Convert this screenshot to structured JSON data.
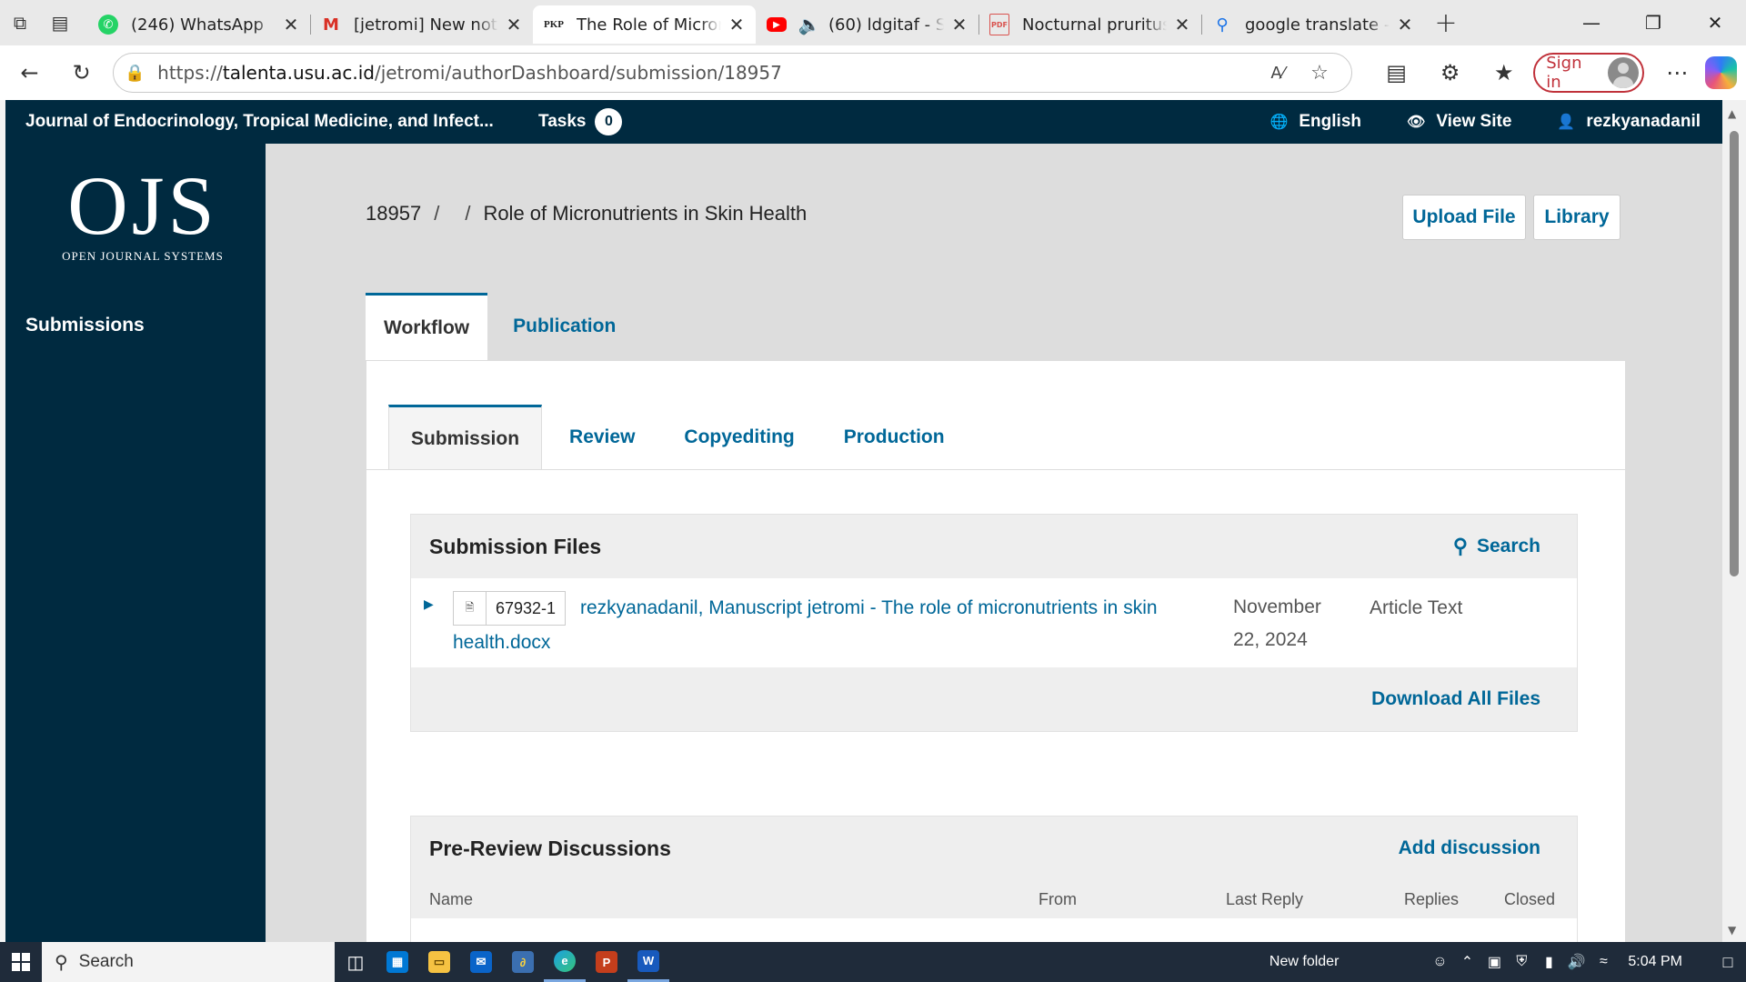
{
  "browser": {
    "tabs": [
      {
        "title": "(246) WhatsApp",
        "favicon": "whatsapp-icon",
        "active": false
      },
      {
        "title": "[jetromi] New notifi",
        "favicon": "gmail-icon",
        "active": false
      },
      {
        "title": "The Role of Micron",
        "favicon": "pkp-icon",
        "favicon_text": "PKP",
        "active": true
      },
      {
        "title": "(60) ldgitaf - S",
        "favicon": "youtube-icon",
        "active": false,
        "audio": true
      },
      {
        "title": "Nocturnal pruritus",
        "favicon": "pdf-icon",
        "active": false
      },
      {
        "title": "google translate - S",
        "favicon": "search-icon",
        "active": false
      }
    ],
    "url_prefix": "https://",
    "url_host": "talenta.usu.ac.id",
    "url_path": "/jetromi/authorDashboard/submission/18957",
    "sign_in": "Sign in"
  },
  "ojs": {
    "journal_name": "Journal of Endocrinology, Tropical Medicine, and Infect...",
    "tasks_label": "Tasks",
    "tasks_count": "0",
    "language": "English",
    "view_site": "View Site",
    "username": "rezkyanadanil",
    "logo_big": "OJS",
    "logo_small": "OPEN JOURNAL SYSTEMS",
    "sidebar_link": "Submissions",
    "breadcrumb": {
      "id": "18957",
      "sep1": "/",
      "sep2": "/",
      "title": "Role of Micronutrients in Skin Health"
    },
    "upload_file": "Upload File",
    "library": "Library",
    "main_tabs": [
      "Workflow",
      "Publication"
    ],
    "stage_tabs": [
      "Submission",
      "Review",
      "Copyediting",
      "Production"
    ],
    "submission_files": {
      "heading": "Submission Files",
      "search": "Search",
      "file": {
        "id": "67932-1",
        "name": "rezkyanadanil, Manuscript jetromi - The role of micronutrients in skin health.docx",
        "date": "November 22, 2024",
        "type": "Article Text"
      },
      "download_all": "Download All Files"
    },
    "discussions": {
      "heading": "Pre-Review Discussions",
      "add": "Add discussion",
      "columns": [
        "Name",
        "From",
        "Last Reply",
        "Replies",
        "Closed"
      ]
    }
  },
  "taskbar": {
    "search": "Search",
    "folder_label": "New folder",
    "time": "5:04 PM"
  },
  "colors": {
    "ojs_dark": "#002a40",
    "ojs_link": "#006798"
  }
}
